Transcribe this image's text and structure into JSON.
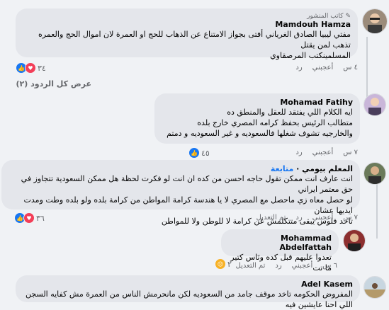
{
  "comments": [
    {
      "badge": "كاتب المنشور",
      "author": "Mamdouh Hamza",
      "lines": [
        "مفتي ليبيا الصادق الغرياني أفتى بجواز الامتناع عن الذهاب للحج او العمرة لان اموال الحج والعمره تذهب لمن يقتل",
        "المسلمينكتب المرصقاوي"
      ],
      "time": "٤ س",
      "like": "أعجبني",
      "reply": "رد",
      "reactions_count": "٣٤"
    },
    {
      "author": "Mohamad Fatihy",
      "lines": [
        "ايه الكلام اللي يفتقد للعقل والمنطق ده",
        "متطالب الرئيس بحفظ كرامه المصري خارج بلده",
        "والخارجيه تشوف شغلها فالسعوديه و غير السعوديه و دمتم"
      ],
      "time": "٧ س",
      "like": "أعجبني",
      "reply": "رد",
      "reactions_count": "٤٥"
    },
    {
      "author": "المعلم بيومي",
      "follow": "متابعة",
      "lines": [
        "انت عارف انت ممكن تقول حاجه احسن من كده ان انت لو فكرت لحظة هل ممكن السعودية تتجاوز في حق معتمر ايراني",
        "لو حصل معاه زي ماحصل مع المصري لا يا هندسة كرامة المواطن من كرامة بلده ولو بلده وطت ومدت ايديها عشان",
        "تاخد فلوس يبقى متتكلمش عن كرامة لا للوطن ولا للمواطن"
      ],
      "time": "٧ س",
      "like": "أعجبني",
      "reply": "رد",
      "edited": "تم التعديل",
      "reactions_count": "٣٦"
    },
    {
      "author": "Mohammad Abdelfattah",
      "lines": [
        "تعدوا عليهم قبل كده ونَاس كتير ما تت"
      ],
      "time": "٦ س",
      "like": "أعجبني",
      "reply": "رد",
      "edited": "تم التعديل",
      "reactions_count": "٢"
    },
    {
      "author": "Adel Kasem",
      "lines": [
        "المفروض الحكومه تاخد موقف جامد من السعوديه لكن مانحرمش الناس من العمرة مش كفايه السجن اللي احنا عايشين فيه"
      ]
    }
  ],
  "view_replies": "عرض كل الردود (٢)",
  "colors": {
    "like": "#1877f2",
    "heart": "#f33e58",
    "sad": "#f7b125",
    "bubble": "#e4e6eb"
  },
  "icons": {
    "author_badge": "pencil-icon",
    "like": "like-reaction-icon",
    "love": "heart-reaction-icon",
    "sad": "sad-reaction-icon"
  }
}
